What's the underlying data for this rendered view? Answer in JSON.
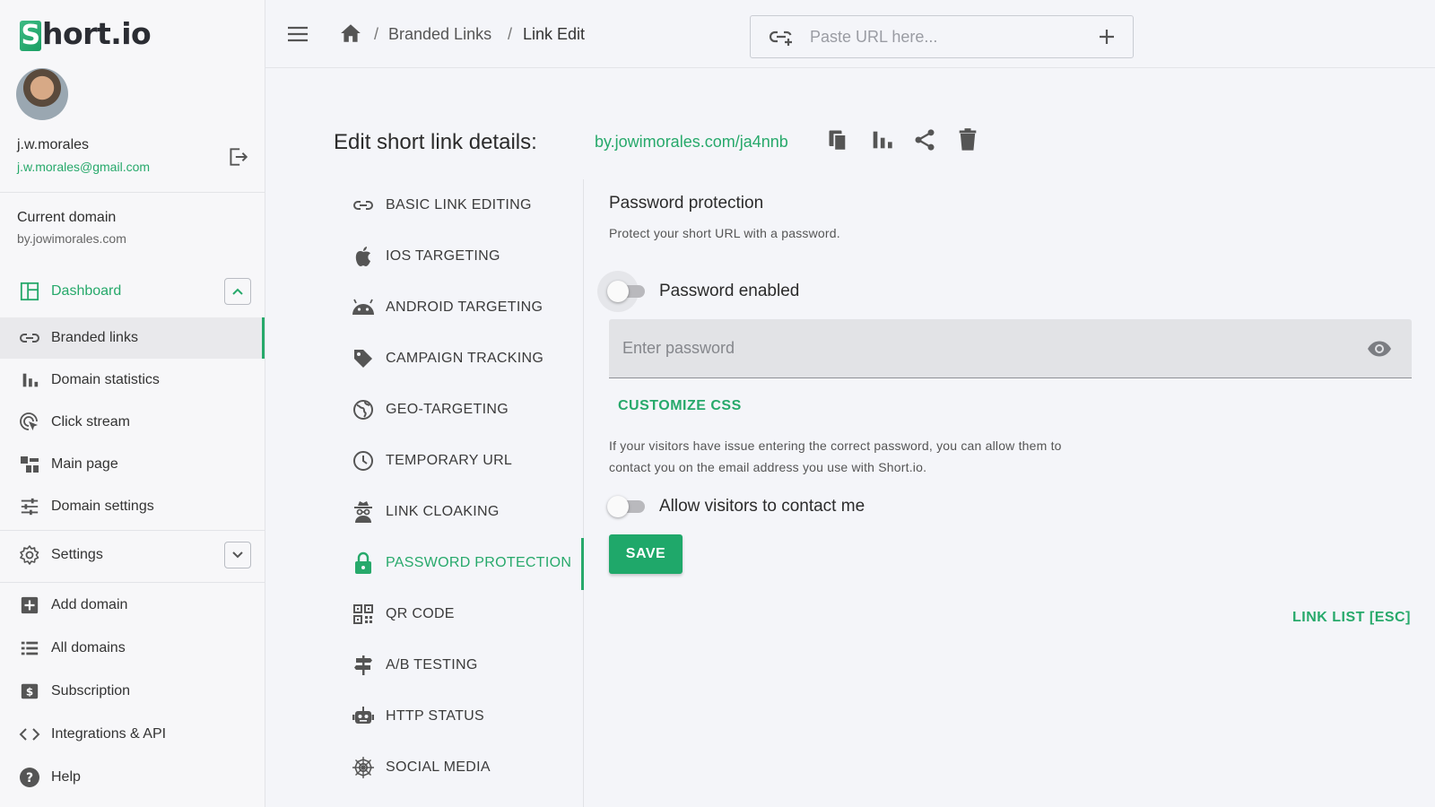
{
  "brand": {
    "logo_s": "S",
    "logo_rest": "hort.io"
  },
  "user": {
    "name": "j.w.morales",
    "email": "j.w.morales@gmail.com"
  },
  "domain": {
    "label": "Current domain",
    "value": "by.jowimorales.com"
  },
  "sidebar": {
    "items": [
      {
        "label": "Dashboard",
        "icon": "dashboard-icon"
      },
      {
        "label": "Branded links",
        "icon": "link-icon"
      },
      {
        "label": "Domain statistics",
        "icon": "bar-chart-icon"
      },
      {
        "label": "Click stream",
        "icon": "click-icon"
      },
      {
        "label": "Main page",
        "icon": "main-page-icon"
      },
      {
        "label": "Domain settings",
        "icon": "sliders-icon"
      },
      {
        "label": "Settings",
        "icon": "gear-icon"
      },
      {
        "label": "Add domain",
        "icon": "plus-box-icon"
      },
      {
        "label": "All domains",
        "icon": "list-icon"
      },
      {
        "label": "Subscription",
        "icon": "dollar-icon"
      },
      {
        "label": "Integrations & API",
        "icon": "code-icon"
      },
      {
        "label": "Help",
        "icon": "help-icon"
      }
    ]
  },
  "breadcrumb": {
    "sep": "/",
    "items": [
      "Branded Links",
      "Link Edit"
    ]
  },
  "url_input": {
    "placeholder": "Paste URL here..."
  },
  "edit": {
    "title": "Edit short link details:",
    "short_link": "by.jowimorales.com/ja4nnb"
  },
  "tabs": [
    {
      "label": "BASIC LINK EDITING",
      "icon": "link-icon"
    },
    {
      "label": "IOS TARGETING",
      "icon": "apple-icon"
    },
    {
      "label": "ANDROID TARGETING",
      "icon": "android-icon"
    },
    {
      "label": "CAMPAIGN TRACKING",
      "icon": "tag-icon"
    },
    {
      "label": "GEO-TARGETING",
      "icon": "globe-icon"
    },
    {
      "label": "TEMPORARY URL",
      "icon": "clock-icon"
    },
    {
      "label": "LINK CLOAKING",
      "icon": "spy-icon"
    },
    {
      "label": "PASSWORD PROTECTION",
      "icon": "lock-icon"
    },
    {
      "label": "QR CODE",
      "icon": "qr-code-icon"
    },
    {
      "label": "A/B TESTING",
      "icon": "signpost-icon"
    },
    {
      "label": "HTTP STATUS",
      "icon": "robot-icon"
    },
    {
      "label": "SOCIAL MEDIA",
      "icon": "spider-web-icon"
    }
  ],
  "active_tab": "PASSWORD PROTECTION",
  "password": {
    "heading": "Password protection",
    "description": "Protect your short URL with a password.",
    "toggle_label": "Password enabled",
    "toggle_on": false,
    "placeholder": "Enter password",
    "customize": "CUSTOMIZE CSS",
    "note": "If your visitors have issue entering the correct password, you can allow them to contact you on the email address you use with Short.io.",
    "contact_label": "Allow visitors to contact me",
    "contact_on": false,
    "save": "SAVE"
  },
  "link_list": "LINK LIST [ESC]",
  "colors": {
    "accent": "#27a96b",
    "save_bg": "#1fa86a"
  }
}
